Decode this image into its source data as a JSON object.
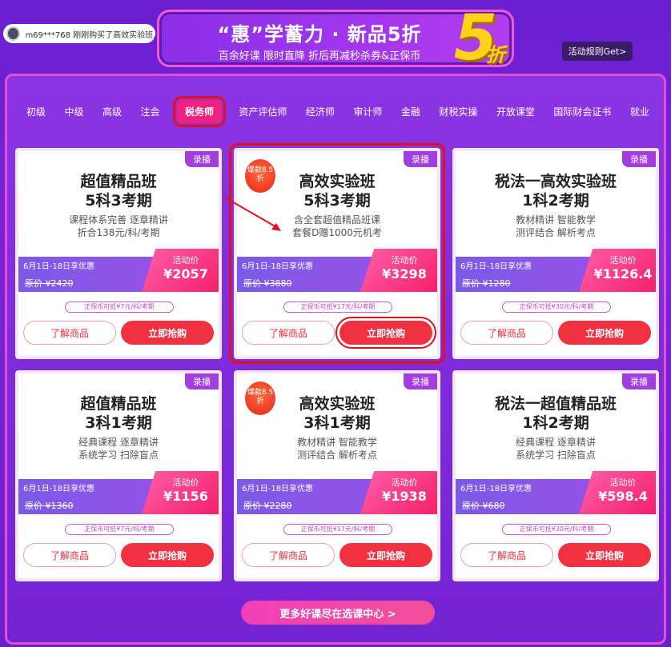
{
  "ticker": {
    "text": "m69***768 刚刚购买了高效实验班..."
  },
  "banner": {
    "title": "“惠”学蓄力 · 新品5折",
    "subtitle": "百余好课 限时直降 折后再减秒杀券&正保币",
    "big": "5",
    "zhe": "折"
  },
  "rules_button": "活动规则Get>",
  "tabs": [
    "初级",
    "中级",
    "高级",
    "注会",
    "税务师",
    "资产评估师",
    "经济师",
    "审计师",
    "金融",
    "财税实操",
    "开放课堂",
    "国际财会证书",
    "就业"
  ],
  "active_tab": "税务师",
  "cards": [
    {
      "tag": "录播",
      "badge": "",
      "name1": "超值精品班",
      "name2": "5科3考期",
      "desc1": "课程体系完善 逐章精讲",
      "desc2": "折合138元/科/考期",
      "date": "6月1日-18日享优惠",
      "orig": "原价 ¥2420",
      "price_label": "活动价",
      "price": "¥2057",
      "coupon": "正保币可抵¥7元/科/考期",
      "info": "了解商品",
      "buy": "立即抢购"
    },
    {
      "tag": "录播",
      "badge": "爆款8.5折",
      "name1": "高效实验班",
      "name2": "5科3考期",
      "desc1": "含全套超值精品班课",
      "desc2": "套餐D赠1000元机考",
      "date": "6月1日-18日享优惠",
      "orig": "原价 ¥3880",
      "price_label": "活动价",
      "price": "¥3298",
      "coupon": "正保币可抵¥17元/科/考期",
      "info": "了解商品",
      "buy": "立即抢购"
    },
    {
      "tag": "录播",
      "badge": "",
      "name1": "税法一高效实验班",
      "name2": "1科2考期",
      "desc1": "教材精讲 智能教学",
      "desc2": "测评结合 解析考点",
      "date": "6月1日-18日享优惠",
      "orig": "原价 ¥1280",
      "price_label": "活动价",
      "price": "¥1126.4",
      "coupon": "正保币可抵¥30元/科/考期",
      "info": "了解商品",
      "buy": "立即抢购"
    },
    {
      "tag": "录播",
      "badge": "",
      "name1": "超值精品班",
      "name2": "3科1考期",
      "desc1": "经典课程 逐章精讲",
      "desc2": "系统学习 扫除盲点",
      "date": "6月1日-18日享优惠",
      "orig": "原价 ¥1360",
      "price_label": "活动价",
      "price": "¥1156",
      "coupon": "正保币可抵¥7元/科/考期",
      "info": "了解商品",
      "buy": "立即抢购"
    },
    {
      "tag": "录播",
      "badge": "爆款8.5折",
      "name1": "高效实验班",
      "name2": "3科1考期",
      "desc1": "教材精讲 智能教学",
      "desc2": "测评结合 解析考点",
      "date": "6月1日-18日享优惠",
      "orig": "原价 ¥2280",
      "price_label": "活动价",
      "price": "¥1938",
      "coupon": "正保币可抵¥17元/科/考期",
      "info": "了解商品",
      "buy": "立即抢购"
    },
    {
      "tag": "录播",
      "badge": "",
      "name1": "税法一超值精品班",
      "name2": "1科2考期",
      "desc1": "经典课程 逐章精讲",
      "desc2": "系统学习 扫除盲点",
      "date": "6月1日-18日享优惠",
      "orig": "原价 ¥680",
      "price_label": "活动价",
      "price": "¥598.4",
      "coupon": "正保币可抵¥30元/科/考期",
      "info": "了解商品",
      "buy": "立即抢购"
    }
  ],
  "more_button": "更多好课尽在选课中心 >"
}
